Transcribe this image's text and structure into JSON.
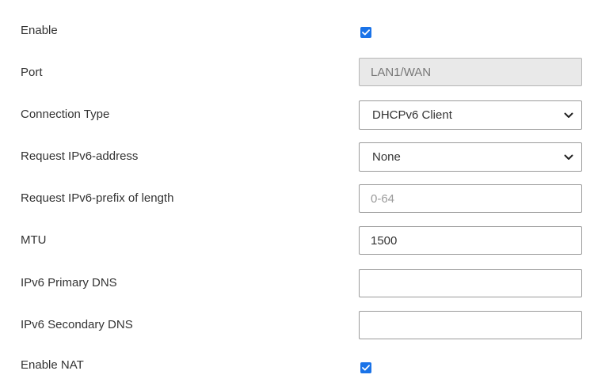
{
  "form": {
    "enable": {
      "label": "Enable",
      "checked": true
    },
    "port": {
      "label": "Port",
      "value": "LAN1/WAN"
    },
    "connection_type": {
      "label": "Connection Type",
      "value": "DHCPv6 Client"
    },
    "request_address": {
      "label": "Request IPv6-address",
      "value": "None"
    },
    "prefix_length": {
      "label": "Request IPv6-prefix of length",
      "value": "",
      "placeholder": "0-64"
    },
    "mtu": {
      "label": "MTU",
      "value": "1500"
    },
    "primary_dns": {
      "label": "IPv6 Primary DNS",
      "value": ""
    },
    "secondary_dns": {
      "label": "IPv6 Secondary DNS",
      "value": ""
    },
    "enable_nat": {
      "label": "Enable NAT",
      "checked": true
    }
  },
  "colors": {
    "checkbox": "#1a73e8",
    "readonly_bg": "#e9e9e9",
    "border": "#9a9a9a"
  },
  "icons": {
    "checkbox": "check-icon",
    "dropdown": "chevron-down-icon"
  }
}
